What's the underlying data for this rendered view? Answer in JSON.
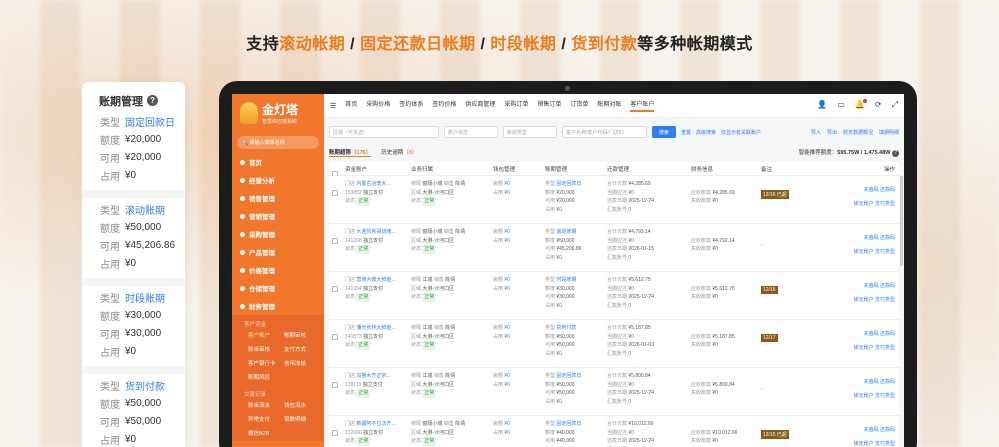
{
  "headline": {
    "prefix": "支持",
    "h1": "滚动帐期",
    "sep1": " / ",
    "h2": "固定还款日帐期",
    "sep2": " / ",
    "h3": "时段帐期",
    "sep3": " / ",
    "h4": "货到付款",
    "suffix": "等多种帐期模式"
  },
  "card": {
    "title": "账期管理",
    "groups": [
      {
        "rows": [
          {
            "k": "类型",
            "v": "固定回款日",
            "blue": true
          },
          {
            "k": "额度",
            "v": "¥20,000"
          },
          {
            "k": "可用",
            "v": "¥20,000"
          },
          {
            "k": "占用",
            "v": "¥0"
          }
        ]
      },
      {
        "rows": [
          {
            "k": "类型",
            "v": "滚动账期",
            "blue": true
          },
          {
            "k": "额度",
            "v": "¥50,000"
          },
          {
            "k": "可用",
            "v": "¥45,206.86"
          },
          {
            "k": "占用",
            "v": "¥0"
          }
        ]
      },
      {
        "rows": [
          {
            "k": "类型",
            "v": "时段账期",
            "blue": true
          },
          {
            "k": "额度",
            "v": "¥30,000"
          },
          {
            "k": "可用",
            "v": "¥30,000"
          },
          {
            "k": "占用",
            "v": "¥0"
          }
        ]
      },
      {
        "rows": [
          {
            "k": "类型",
            "v": "货到付款",
            "blue": true
          },
          {
            "k": "额度",
            "v": "¥50,000"
          },
          {
            "k": "可用",
            "v": "¥50,000"
          },
          {
            "k": "占用",
            "v": "¥0"
          }
        ]
      }
    ]
  },
  "app": {
    "logo_name": "金灯塔",
    "logo_sub": "智慧供应链系统",
    "search_placeholder": "请输入菜单名称",
    "menu": [
      "首页",
      "经营分析",
      "销售管理",
      "营销管理",
      "采购管理",
      "产品管理",
      "价格管理",
      "仓储管理",
      "财务管理"
    ],
    "sub_section_1": "客户资金",
    "sub_items_1": [
      "客户账户",
      "账期审核",
      "账余审核",
      "支付方式",
      "客户银行卡",
      "信用冻结",
      "账期风控"
    ],
    "sub_section_2": "交易记录",
    "sub_items_2": [
      "账余流水",
      "钱包流水",
      "异常支付",
      "银数明细",
      "微信B2B"
    ],
    "topnav": [
      "首页",
      "采购价格",
      "签约体系",
      "签约价格",
      "供应商管理",
      "采购订单",
      "销售订单",
      "订货单",
      "账期对账",
      "客户账户"
    ],
    "filters": [
      "区域（可多选）",
      "账户状态",
      "账期类型",
      "客户名称/客户代码/门店ID"
    ],
    "search_btn": "搜索",
    "reset": "重置",
    "advanced": "高级搜索",
    "batch": "仅显示有关联账户",
    "right_actions": [
      "导入",
      "导出",
      "财务数据概况",
      "填期明细"
    ],
    "tab_active": "账期超限",
    "tab_active_count": "（176）",
    "tab2": "历史逾期",
    "tab2_count": "（8）",
    "credit_label": "智能推荐额度：",
    "credit_value": "595.75W / 1,475.48W",
    "headers": [
      "资金账户",
      "业务归属",
      "钱包管理",
      "账期管理",
      "还款管理",
      "财务信息",
      "备注",
      "操作"
    ]
  },
  "rows": [
    {
      "name": "内蒙古洽李大...",
      "id": "153882",
      "pay": "独立支付",
      "status": "正常",
      "biz": "窗隔小城",
      "sales": "陈倩",
      "region": "大港-沙河口区",
      "wallet_rest": "¥0",
      "wallet_used": "¥0",
      "type": "固定回款日",
      "limit": "¥20,000",
      "avail": "¥20,000",
      "used": "¥0",
      "total": "¥4,285.69",
      "overdue": "¥0",
      "due": "2025-12-24",
      "count": "0",
      "fin_recv": "¥4,285.69",
      "fin_paid": "¥0",
      "note": "12/16 已超",
      "op1": "充值码",
      "op2": "还款码",
      "op3": "锁定账户",
      "op4": "支付类型"
    },
    {
      "name": "大连凯希哥烧烤...",
      "id": "141268",
      "pay": "独立支付",
      "status": "正常",
      "biz": "窗隔小城",
      "sales": "陈倩",
      "region": "大港-沙河口区",
      "wallet_rest": "¥0",
      "wallet_used": "¥0",
      "type": "滚动账期",
      "limit": "¥50,000",
      "avail": "¥45,206.86",
      "used": "¥0",
      "total": "¥4,793.14",
      "overdue": "¥0",
      "due": "2026-01-15",
      "count": "0",
      "fin_recv": "¥4,792.14",
      "fin_paid": "¥0",
      "note": "-",
      "op1": "充值码",
      "op2": "还款码",
      "op3": "锁定账户",
      "op4": "支付类型"
    },
    {
      "name": "营荷大螃大鲜鱼...",
      "id": "141054",
      "pay": "独立支付",
      "status": "正常",
      "biz": "江城",
      "sales": "陈倩",
      "region": "大港-沙河口区",
      "wallet_rest": "¥0",
      "wallet_used": "¥0",
      "type": "时段账期",
      "limit": "¥30,000",
      "avail": "¥30,000",
      "used": "¥0",
      "total": "¥5,612.75",
      "overdue": "¥0",
      "due": "2025-12-24",
      "count": "0",
      "fin_recv": "¥5,612.75",
      "fin_paid": "¥0",
      "note": "12/16",
      "op1": "充值码",
      "op2": "还款码",
      "op3": "锁定账户",
      "op4": "支付类型"
    },
    {
      "name": "潘光张林大鲜鱼...",
      "id": "140873",
      "pay": "独立支付",
      "status": "正常",
      "biz": "江城",
      "sales": "陈倩",
      "region": "大港-沙河口区",
      "wallet_rest": "¥0",
      "wallet_used": "¥0",
      "type": "货到付款",
      "limit": "¥50,000",
      "avail": "¥50,000",
      "used": "¥0",
      "total": "¥5,187.85",
      "overdue": "¥0",
      "due": "2026-01-03",
      "count": "0",
      "fin_recv": "¥5,187.85",
      "fin_paid": "¥0",
      "note": "12/17",
      "op1": "充值码",
      "op2": "还款码",
      "op3": "锁定账户",
      "op4": "支付类型"
    },
    {
      "name": "乌鲁木齐正宗...",
      "id": "138113",
      "pay": "独立支付",
      "status": "正常",
      "biz": "江城",
      "sales": "陈倩",
      "region": "大港-沙河口区",
      "wallet_rest": "¥0",
      "wallet_used": "¥0",
      "type": "固定回款日",
      "limit": "¥50,000",
      "avail": "¥50,000",
      "used": "¥0",
      "total": "¥5,800.84",
      "overdue": "¥0",
      "due": "2025-12-24",
      "count": "0",
      "fin_recv": "¥5,800.84",
      "fin_paid": "¥0",
      "note": "-",
      "op1": "充值码",
      "op2": "还款码",
      "op3": "锁定账户",
      "op4": "支付类型"
    },
    {
      "name": "新疆阿不拉法齐...",
      "id": "132066",
      "pay": "独立支付",
      "status": "正常",
      "biz": "窗隔小城",
      "sales": "陈倩",
      "region": "大港-沙河口区",
      "wallet_rest": "¥0",
      "wallet_used": "¥0",
      "type": "固定回款日",
      "limit": "¥40,000",
      "avail": "¥40,000",
      "used": "¥0",
      "total": "¥10,012.66",
      "overdue": "¥0",
      "due": "2025-12-24",
      "count": "0",
      "fin_recv": "¥10,012.66",
      "fin_paid": "¥0",
      "note": "12/15 已超",
      "op1": "充值码",
      "op2": "还款码",
      "op3": "锁定账户",
      "op4": "支付类型"
    }
  ],
  "labels": {
    "shop": "门店",
    "region": "区域",
    "biz": "窗隔",
    "sales": "销售",
    "rest": "余额",
    "used_short": "占用",
    "type": "类型",
    "limit": "额度",
    "avail": "可用",
    "used": "占用",
    "total": "合计欠款",
    "overdue": "当期应还",
    "due": "还款日期",
    "count": "汇款账号",
    "fin_recv": "应收账款",
    "fin_paid": "实收账款",
    "state": "状态"
  }
}
